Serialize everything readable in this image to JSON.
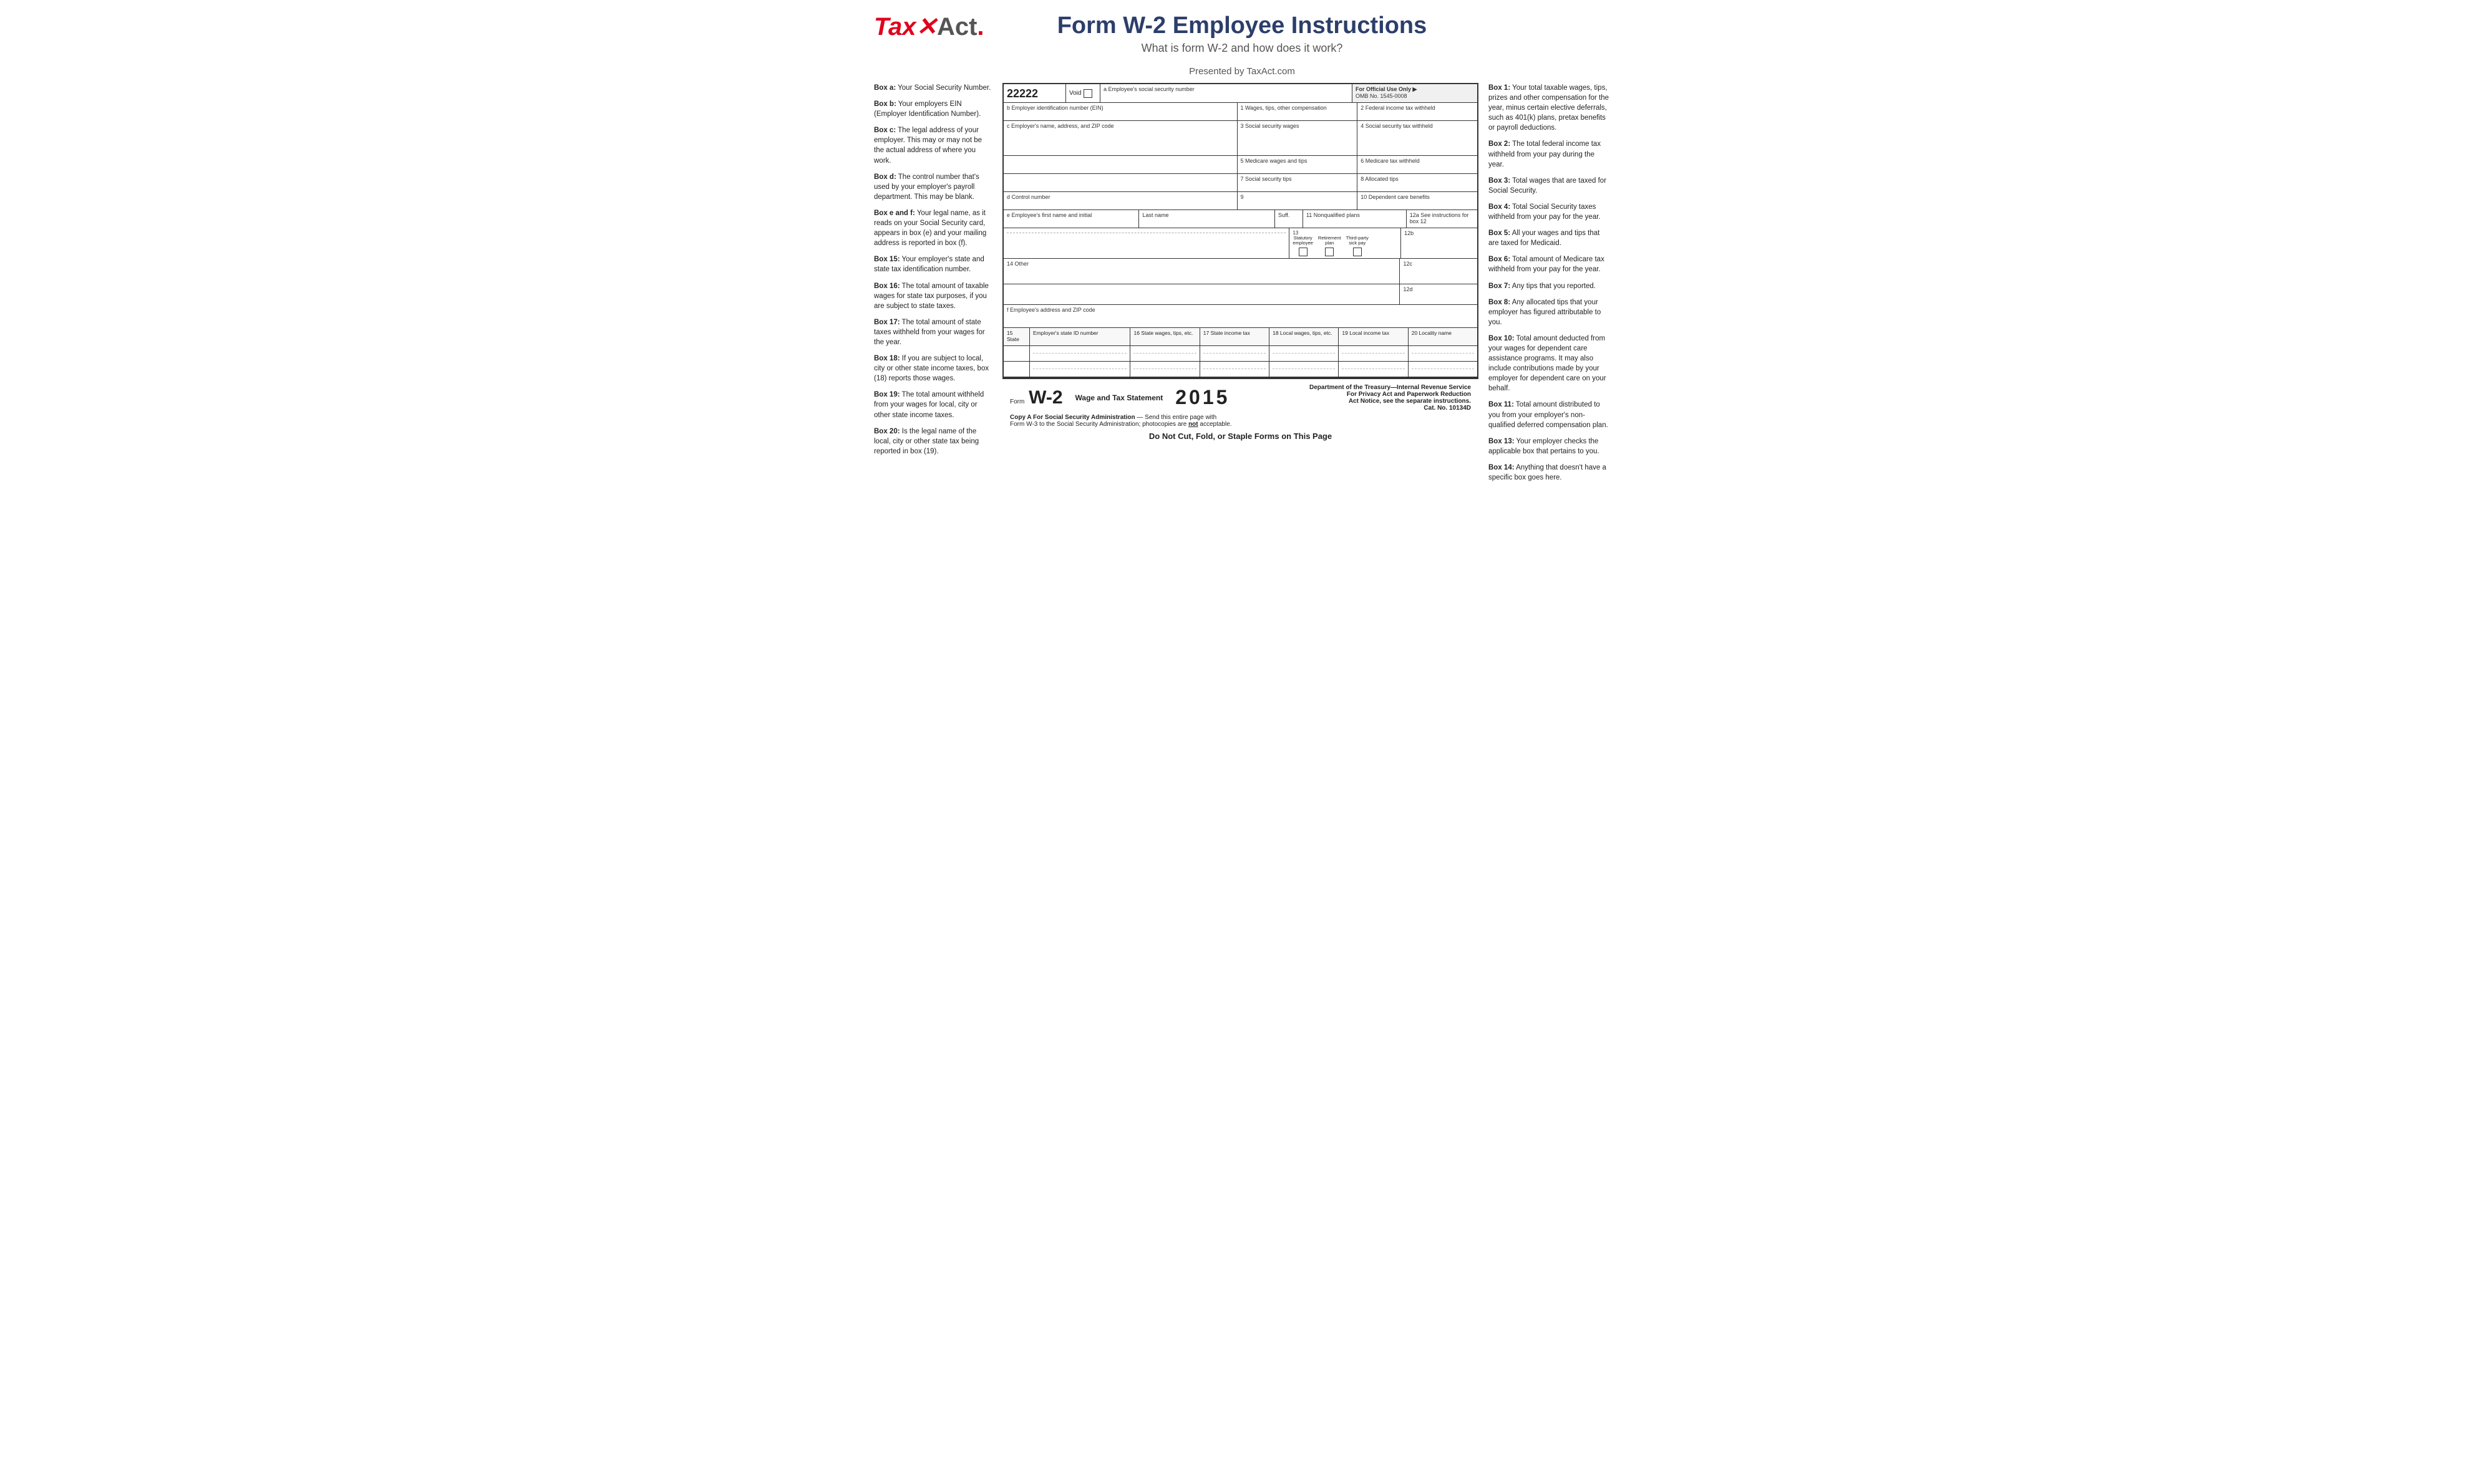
{
  "header": {
    "logo_tax": "Tax",
    "logo_act": "Act",
    "logo_dot": ".",
    "title": "Form W-2 Employee Instructions",
    "subtitle": "What is form W-2 and how does it work?",
    "presented_by": "Presented by TaxAct.com"
  },
  "left_sidebar": [
    {
      "key": "box_a",
      "label": "Box a:",
      "text": "Your Social Security Number."
    },
    {
      "key": "box_b",
      "label": "Box b:",
      "text": "Your employers EIN (Employer Identification Number)."
    },
    {
      "key": "box_c",
      "label": "Box c:",
      "text": "The legal address of your employer. This may or may not be the actual address of where you work."
    },
    {
      "key": "box_d",
      "label": "Box d:",
      "text": "The control number that's used by your employer's payroll department. This may be blank."
    },
    {
      "key": "box_ef",
      "label": "Box e and f:",
      "text": "Your legal name, as it reads on your Social Security card, appears in box (e) and your mailing address is reported in box (f)."
    },
    {
      "key": "box_15",
      "label": "Box 15:",
      "text": "Your employer's state and state tax identification number."
    },
    {
      "key": "box_16",
      "label": "Box 16:",
      "text": "The total amount of taxable wages for state tax purposes, if you are subject to state taxes."
    },
    {
      "key": "box_17",
      "label": "Box 17:",
      "text": "The total amount of state taxes withheld from your wages for the year."
    },
    {
      "key": "box_18",
      "label": "Box 18:",
      "text": "If you are subject to local, city or other state income taxes, box (18) reports those wages."
    },
    {
      "key": "box_19",
      "label": "Box 19:",
      "text": "The total amount withheld from your wages for local, city or other state income taxes."
    },
    {
      "key": "box_20",
      "label": "Box 20:",
      "text": "Is the legal name of the local, city or other state tax being reported in box (19)."
    }
  ],
  "right_sidebar": [
    {
      "key": "box_1",
      "label": "Box 1:",
      "text": "Your total taxable wages, tips, prizes and other compensation for the year, minus certain elective deferrals, such as 401(k) plans, pretax benefits or payroll deductions."
    },
    {
      "key": "box_2",
      "label": "Box 2:",
      "text": "The total federal income tax withheld from your pay during the year."
    },
    {
      "key": "box_3",
      "label": "Box 3:",
      "text": "Total wages that are taxed for Social Security."
    },
    {
      "key": "box_4",
      "label": "Box 4:",
      "text": "Total Social Security taxes withheld from your pay for the year."
    },
    {
      "key": "box_5",
      "label": "Box 5:",
      "text": "All your wages and tips that are taxed for Medicaid."
    },
    {
      "key": "box_6",
      "label": "Box 6:",
      "text": "Total amount of Medicare tax withheld from your pay for the year."
    },
    {
      "key": "box_7",
      "label": "Box 7:",
      "text": "Any tips that you reported."
    },
    {
      "key": "box_8",
      "label": "Box 8:",
      "text": "Any allocated tips that your employer has figured attributable to you."
    },
    {
      "key": "box_10",
      "label": "Box 10:",
      "text": "Total amount deducted from your wages for dependent care assistance programs. It may also include contributions made by your employer for dependent care on your behalf."
    },
    {
      "key": "box_11",
      "label": "Box 11:",
      "text": "Total amount distributed to you from your employer's non-qualified deferred compensation plan."
    },
    {
      "key": "box_13",
      "label": "Box 13:",
      "text": "Your employer checks the applicable box that pertains to you."
    },
    {
      "key": "box_14",
      "label": "Box 14:",
      "text": "Anything that doesn't have a specific box goes here."
    }
  ],
  "form": {
    "control_number_val": "22222",
    "void_label": "Void",
    "ssn_label": "a  Employee's social security number",
    "official_use_label": "For Official Use Only ▶",
    "omb_label": "OMB No. 1545-0008",
    "ein_label": "b  Employer identification number (EIN)",
    "wages_label": "1  Wages, tips, other compensation",
    "federal_tax_label": "2  Federal income tax withheld",
    "employer_name_label": "c  Employer's name, address, and ZIP code",
    "ss_wages_label": "3  Social security wages",
    "ss_tax_label": "4  Social security tax withheld",
    "medicare_wages_label": "5  Medicare wages and tips",
    "medicare_tax_label": "6  Medicare tax withheld",
    "ss_tips_label": "7  Social security tips",
    "alloc_tips_label": "8  Allocated tips",
    "control_label": "d  Control number",
    "box9_label": "9",
    "dep_care_label": "10  Dependent care benefits",
    "emp_firstname_label": "e  Employee's first name and initial",
    "emp_lastname_label": "Last name",
    "suff_label": "Suff.",
    "nonqual_label": "11  Nonqualified plans",
    "box12a_label": "12a  See instructions for box 12",
    "box12b_label": "12b",
    "statutory_label": "Statutory\nemployee",
    "retirement_label": "Retirement\nplan",
    "thirdparty_label": "Third-party\nsick pay",
    "box13_label": "13",
    "box14_label": "14  Other",
    "box12c_label": "12c",
    "box12d_label": "12d",
    "emp_address_label": "f  Employee's address and ZIP code",
    "box15_label": "15  State",
    "state_id_label": "Employer's state ID number",
    "state_wages_label": "16  State wages, tips, etc.",
    "state_income_label": "17  State income tax",
    "local_wages_label": "18  Local wages, tips, etc.",
    "local_income_label": "19  Local income tax",
    "locality_label": "20  Locality name",
    "footer_form_label": "Form",
    "footer_w2_label": "W-2",
    "footer_desc": "Wage and Tax Statement",
    "footer_year": "2015",
    "footer_dept": "Department of the Treasury—Internal Revenue Service",
    "footer_privacy": "For Privacy Act and Paperwork Reduction",
    "footer_act_notice": "Act Notice, see the separate instructions.",
    "footer_cat": "Cat. No. 10134D",
    "footer_copy_label": "Copy A For Social Security Administration",
    "footer_copy_text": "— Send this entire page with",
    "footer_copy_line2": "Form W-3 to the Social Security Administration; photocopies are",
    "footer_not": "not",
    "footer_copy_line2_end": "acceptable.",
    "footer_donotcut": "Do Not Cut, Fold, or Staple Forms on This Page"
  }
}
